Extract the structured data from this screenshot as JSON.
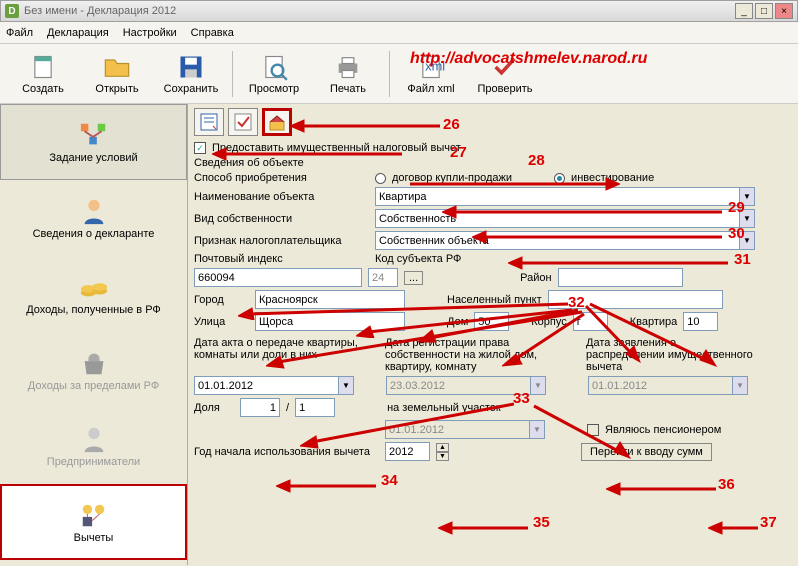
{
  "window": {
    "title": "Без имени - Декларация 2012",
    "icon_letter": "D"
  },
  "menu": [
    "Файл",
    "Декларация",
    "Настройки",
    "Справка"
  ],
  "toolbar": {
    "create": "Создать",
    "open": "Открыть",
    "save": "Сохранить",
    "preview": "Просмотр",
    "print": "Печать",
    "xml": "Файл xml",
    "check": "Проверить"
  },
  "url_overlay": "http://advocatshmelev.narod.ru",
  "sidebar": {
    "items": [
      {
        "label": "Задание условий"
      },
      {
        "label": "Сведения о декларанте"
      },
      {
        "label": "Доходы, полученные в РФ"
      },
      {
        "label": "Доходы за пределами РФ"
      },
      {
        "label": "Предприниматели"
      },
      {
        "label": "Вычеты"
      }
    ]
  },
  "content": {
    "checkbox_label": "Предоставить имущественный налоговый вычет",
    "section_title": "Сведения об объекте",
    "row_method": "Способ приобретения",
    "radio1": "договор купли-продажи",
    "radio2": "инвестирование",
    "row_name": "Наименование объекта",
    "val_name": "Квартира",
    "row_owner": "Вид собственности",
    "val_owner": "Собственность",
    "row_taxpayer": "Признак налогоплательщика",
    "val_taxpayer": "Собственник объекта",
    "row_zip": "Почтовый индекс",
    "val_zip": "660094",
    "row_region": "Код субъекта РФ",
    "val_region": "24",
    "row_district": "Район",
    "row_city": "Город",
    "val_city": "Красноярск",
    "row_locality": "Населенный пункт",
    "row_street": "Улица",
    "val_street": "Щорса",
    "row_house": "Дом",
    "val_house": "50",
    "row_building": "Корпус",
    "val_building": "г",
    "row_flat": "Квартира",
    "val_flat": "10",
    "row_date_act": "Дата акта о передаче квартиры, комнаты или доли в них",
    "val_date_act": "01.01.2012",
    "row_date_reg": "Дата регистрации права собственности на жилой дом, квартиру, комнату",
    "val_date_reg": "23.03.2012",
    "row_date_app": "Дата заявления о распределении имущественного вычета",
    "val_date_app": "01.01.2012",
    "row_share": "Доля",
    "val_share_a": "1",
    "val_share_b": "1",
    "row_land": "на земельный участок",
    "val_land": "01.01.2012",
    "chk_pensioner": "Являюсь пенсионером",
    "row_year": "Год начала использования вычета",
    "val_year": "2012",
    "btn_go": "Перейти к вводу сумм"
  },
  "annotations": {
    "n26": "26",
    "n27": "27",
    "n28": "28",
    "n29": "29",
    "n30": "30",
    "n31": "31",
    "n32": "32",
    "n33": "33",
    "n34": "34",
    "n35": "35",
    "n36": "36",
    "n37": "37"
  }
}
